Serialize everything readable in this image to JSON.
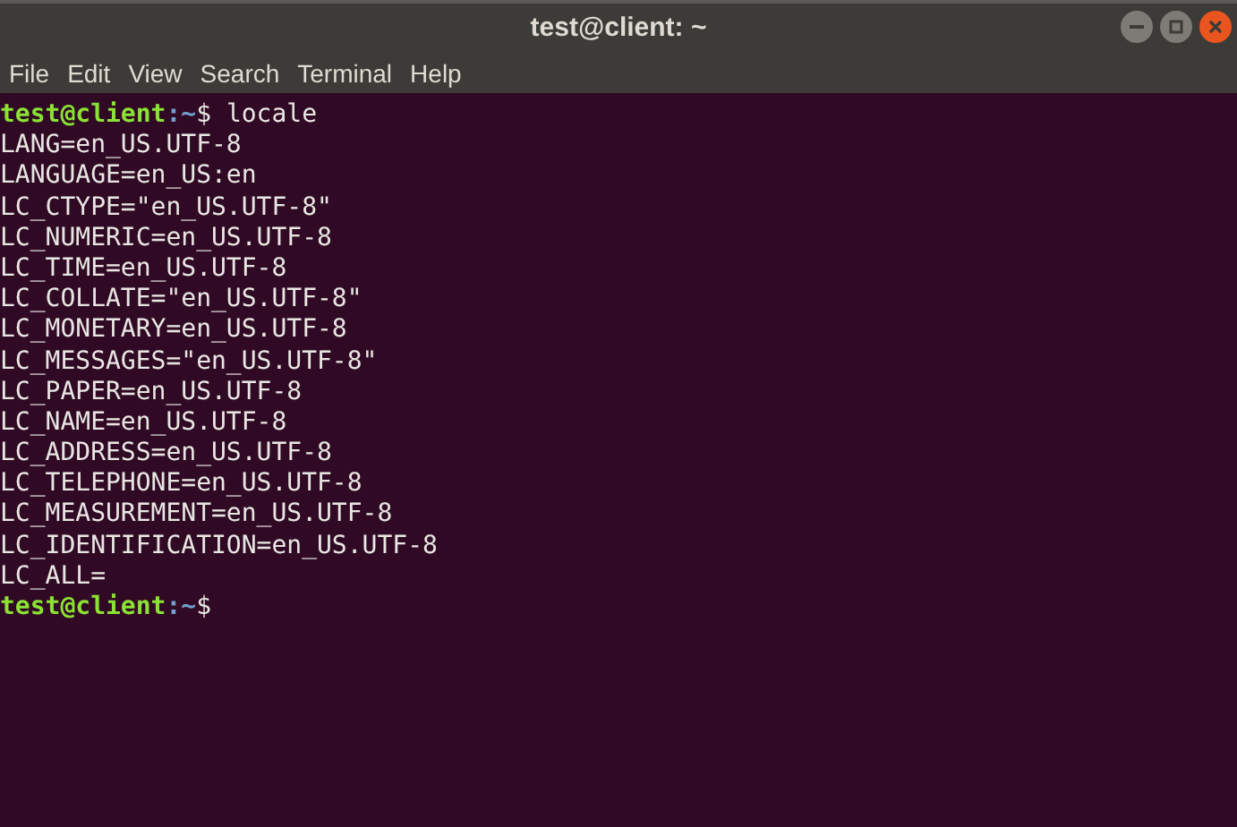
{
  "window": {
    "title": "test@client: ~"
  },
  "menu": [
    "File",
    "Edit",
    "View",
    "Search",
    "Terminal",
    "Help"
  ],
  "terminal_lines": [
    {
      "kind": "prompt",
      "user_host": "test@client",
      "path": ":~",
      "symbol": "$",
      "command": " locale"
    },
    {
      "kind": "output",
      "text": "LANG=en_US.UTF-8"
    },
    {
      "kind": "output",
      "text": "LANGUAGE=en_US:en"
    },
    {
      "kind": "output",
      "text": "LC_CTYPE=\"en_US.UTF-8\""
    },
    {
      "kind": "output",
      "text": "LC_NUMERIC=en_US.UTF-8"
    },
    {
      "kind": "output",
      "text": "LC_TIME=en_US.UTF-8"
    },
    {
      "kind": "output",
      "text": "LC_COLLATE=\"en_US.UTF-8\""
    },
    {
      "kind": "output",
      "text": "LC_MONETARY=en_US.UTF-8"
    },
    {
      "kind": "output",
      "text": "LC_MESSAGES=\"en_US.UTF-8\""
    },
    {
      "kind": "output",
      "text": "LC_PAPER=en_US.UTF-8"
    },
    {
      "kind": "output",
      "text": "LC_NAME=en_US.UTF-8"
    },
    {
      "kind": "output",
      "text": "LC_ADDRESS=en_US.UTF-8"
    },
    {
      "kind": "output",
      "text": "LC_TELEPHONE=en_US.UTF-8"
    },
    {
      "kind": "output",
      "text": "LC_MEASUREMENT=en_US.UTF-8"
    },
    {
      "kind": "output",
      "text": "LC_IDENTIFICATION=en_US.UTF-8"
    },
    {
      "kind": "output",
      "text": "LC_ALL="
    },
    {
      "kind": "prompt",
      "user_host": "test@client",
      "path": ":~",
      "symbol": "$"
    }
  ]
}
